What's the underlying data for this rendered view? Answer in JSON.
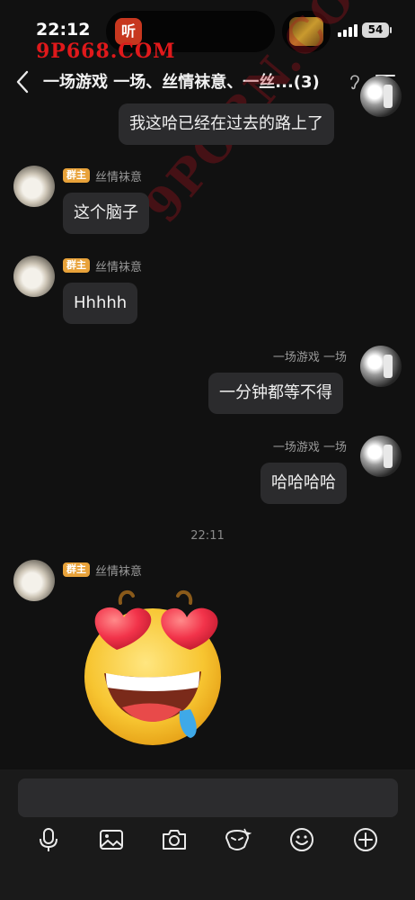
{
  "status_bar": {
    "time": "22:12",
    "island_app_glyph": "听",
    "watermark": "9P668.COM",
    "battery": "54",
    "icons": [
      "signal-icon",
      "battery-icon"
    ]
  },
  "nav": {
    "title": "一场游戏 一场、丝情袜意、一丝...(3)",
    "icons": [
      "back-icon",
      "ear-icon",
      "menu-icon"
    ]
  },
  "watermark_mid": "9PORN.COM",
  "messages": [
    {
      "side": "right",
      "text": "我这哈已经在过去的路上了"
    },
    {
      "side": "left",
      "sender": "丝情袜意",
      "badge": "群主",
      "text": "这个脑子"
    },
    {
      "side": "left",
      "sender": "丝情袜意",
      "badge": "群主",
      "text": "Hhhhh"
    },
    {
      "side": "right",
      "sender": "一场游戏 一场",
      "text": "一分钟都等不得"
    },
    {
      "side": "right",
      "sender": "一场游戏 一场",
      "text": "哈哈哈哈"
    },
    {
      "side": "left",
      "sender": "丝情袜意",
      "badge": "群主",
      "sticker": "heart-eyes-drool-emoji"
    }
  ],
  "timestamp": "22:11",
  "input": {
    "placeholder": ""
  },
  "toolbar": [
    "microphone-icon",
    "image-icon",
    "camera-icon",
    "sticker-icon",
    "smiley-icon",
    "plus-icon"
  ],
  "colors": {
    "background": "#111111",
    "bubble": "#2b2b2d",
    "badge": "#e8a23a",
    "watermark": "#e0191b"
  }
}
